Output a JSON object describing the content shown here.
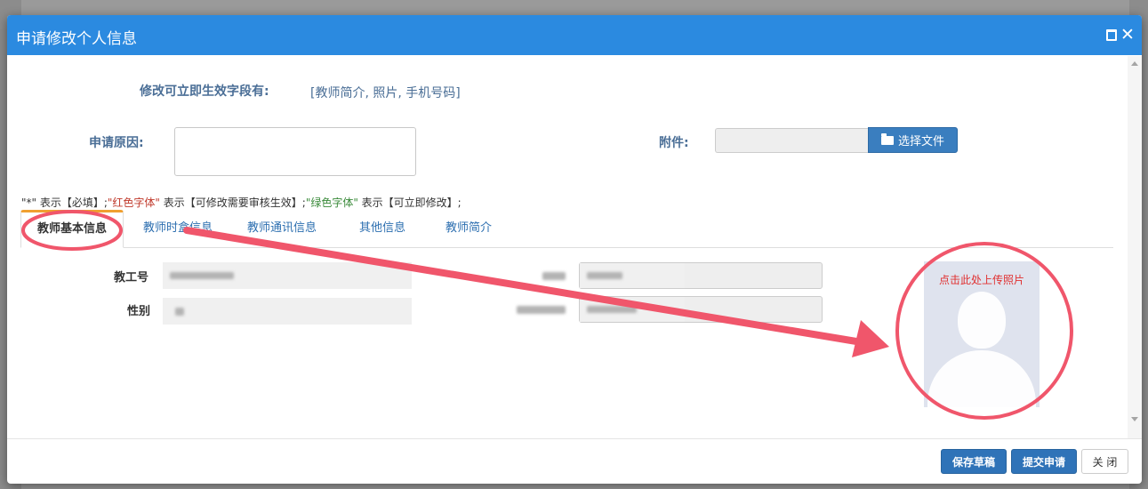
{
  "modal": {
    "title": "申请修改个人信息"
  },
  "instant_fields": {
    "label": "修改可立即生效字段有:",
    "value": "[教师简介, 照片, 手机号码]"
  },
  "reason": {
    "label": "申请原因:",
    "value": ""
  },
  "attachment": {
    "label": "附件:",
    "button_label": "选择文件",
    "button_icon": "folder-open-icon"
  },
  "legend": {
    "part1": "\"*\" 表示【必填】;",
    "red_text": "\"红色字体\"",
    "part2": " 表示【可修改需要审核生效】;",
    "green_text": "\"绿色字体\"",
    "part3": " 表示【可立即修改】;"
  },
  "tabs": [
    {
      "label": "教师基本信息",
      "active": true
    },
    {
      "label": "教师时盒信息",
      "active": false
    },
    {
      "label": "教师通讯信息",
      "active": false
    },
    {
      "label": "其他信息",
      "active": false
    },
    {
      "label": "教师简介",
      "active": false
    }
  ],
  "form": {
    "staff_id_label": "教工号",
    "gender_label": "性别"
  },
  "photo": {
    "upload_text": "点击此处上传照片"
  },
  "footer": {
    "save_draft": "保存草稿",
    "submit": "提交申请",
    "close": "关 闭"
  },
  "colors": {
    "header": "#2b8ae0",
    "primary_button": "#2f73b8",
    "annotation": "#f0566b"
  }
}
